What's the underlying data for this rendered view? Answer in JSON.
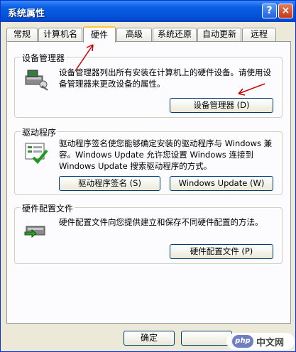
{
  "window": {
    "title": "系统属性",
    "help_glyph": "?",
    "close_glyph": "×"
  },
  "tabs": [
    {
      "label": "常规"
    },
    {
      "label": "计算机名"
    },
    {
      "label": "硬件",
      "active": true
    },
    {
      "label": "高级"
    },
    {
      "label": "系统还原"
    },
    {
      "label": "自动更新"
    },
    {
      "label": "远程"
    }
  ],
  "groups": {
    "device_manager": {
      "title": "设备管理器",
      "description": "设备管理器列出所有安装在计算机上的硬件设备。请使用设备管理器来更改设备的属性。",
      "button": "设备管理器 (D)"
    },
    "driver": {
      "title": "驱动程序",
      "description": "驱动程序签名使您能够确定安装的驱动程序与 Windows 兼容。Windows Update 允许您设置 Windows 连接到 Windows Update 搜索驱动程序的方式。",
      "button_signing": "驱动程序签名 (S)",
      "button_update": "Windows Update (W)"
    },
    "hardware_profiles": {
      "title": "硬件配置文件",
      "description": "硬件配置文件向您提供建立和保存不同硬件配置的方法。",
      "button": "硬件配置文件 (P)"
    }
  },
  "footer": {
    "ok": "确定"
  },
  "watermark": {
    "badge": "php",
    "text": "中文网"
  },
  "colors": {
    "accent": "#0a5fe4",
    "tab_highlight": "#ffc83c",
    "arrow": "#cc0000"
  }
}
